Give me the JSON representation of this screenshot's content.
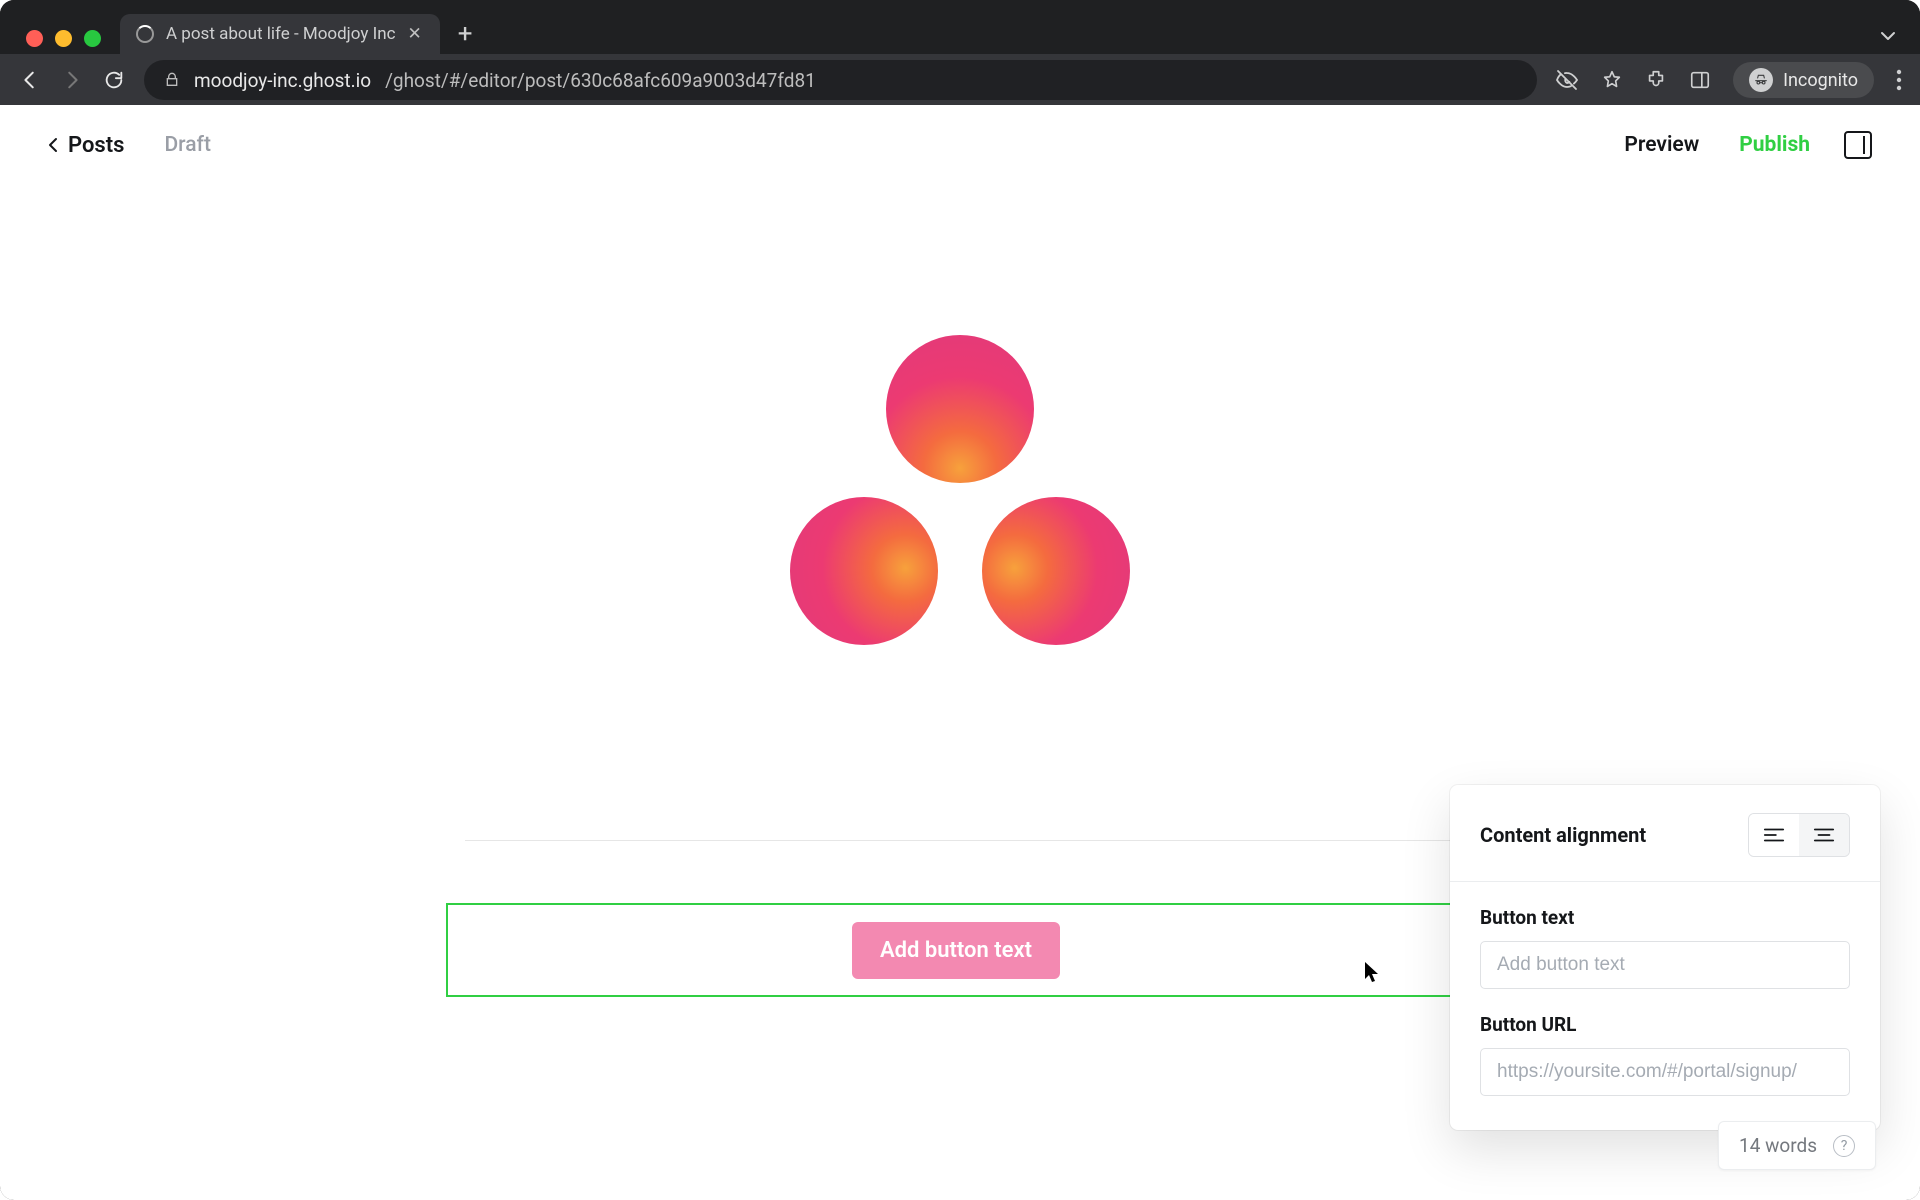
{
  "browser": {
    "tab_title": "A post about life - Moodjoy Inc",
    "url_host": "moodjoy-inc.ghost.io",
    "url_path": "/ghost/#/editor/post/630c68afc609a9003d47fd81",
    "incognito_label": "Incognito"
  },
  "header": {
    "back_label": "Posts",
    "status_label": "Draft",
    "preview_label": "Preview",
    "publish_label": "Publish"
  },
  "button_card": {
    "placeholder_label": "Add button text"
  },
  "popover": {
    "alignment_label": "Content alignment",
    "button_text_label": "Button text",
    "button_text_placeholder": "Add button text",
    "button_url_label": "Button URL",
    "button_url_placeholder": "https://yoursite.com/#/portal/signup/"
  },
  "footer": {
    "word_count_label": "14 words"
  },
  "colors": {
    "accent_green": "#30cf43",
    "button_pink": "#f389b1"
  }
}
